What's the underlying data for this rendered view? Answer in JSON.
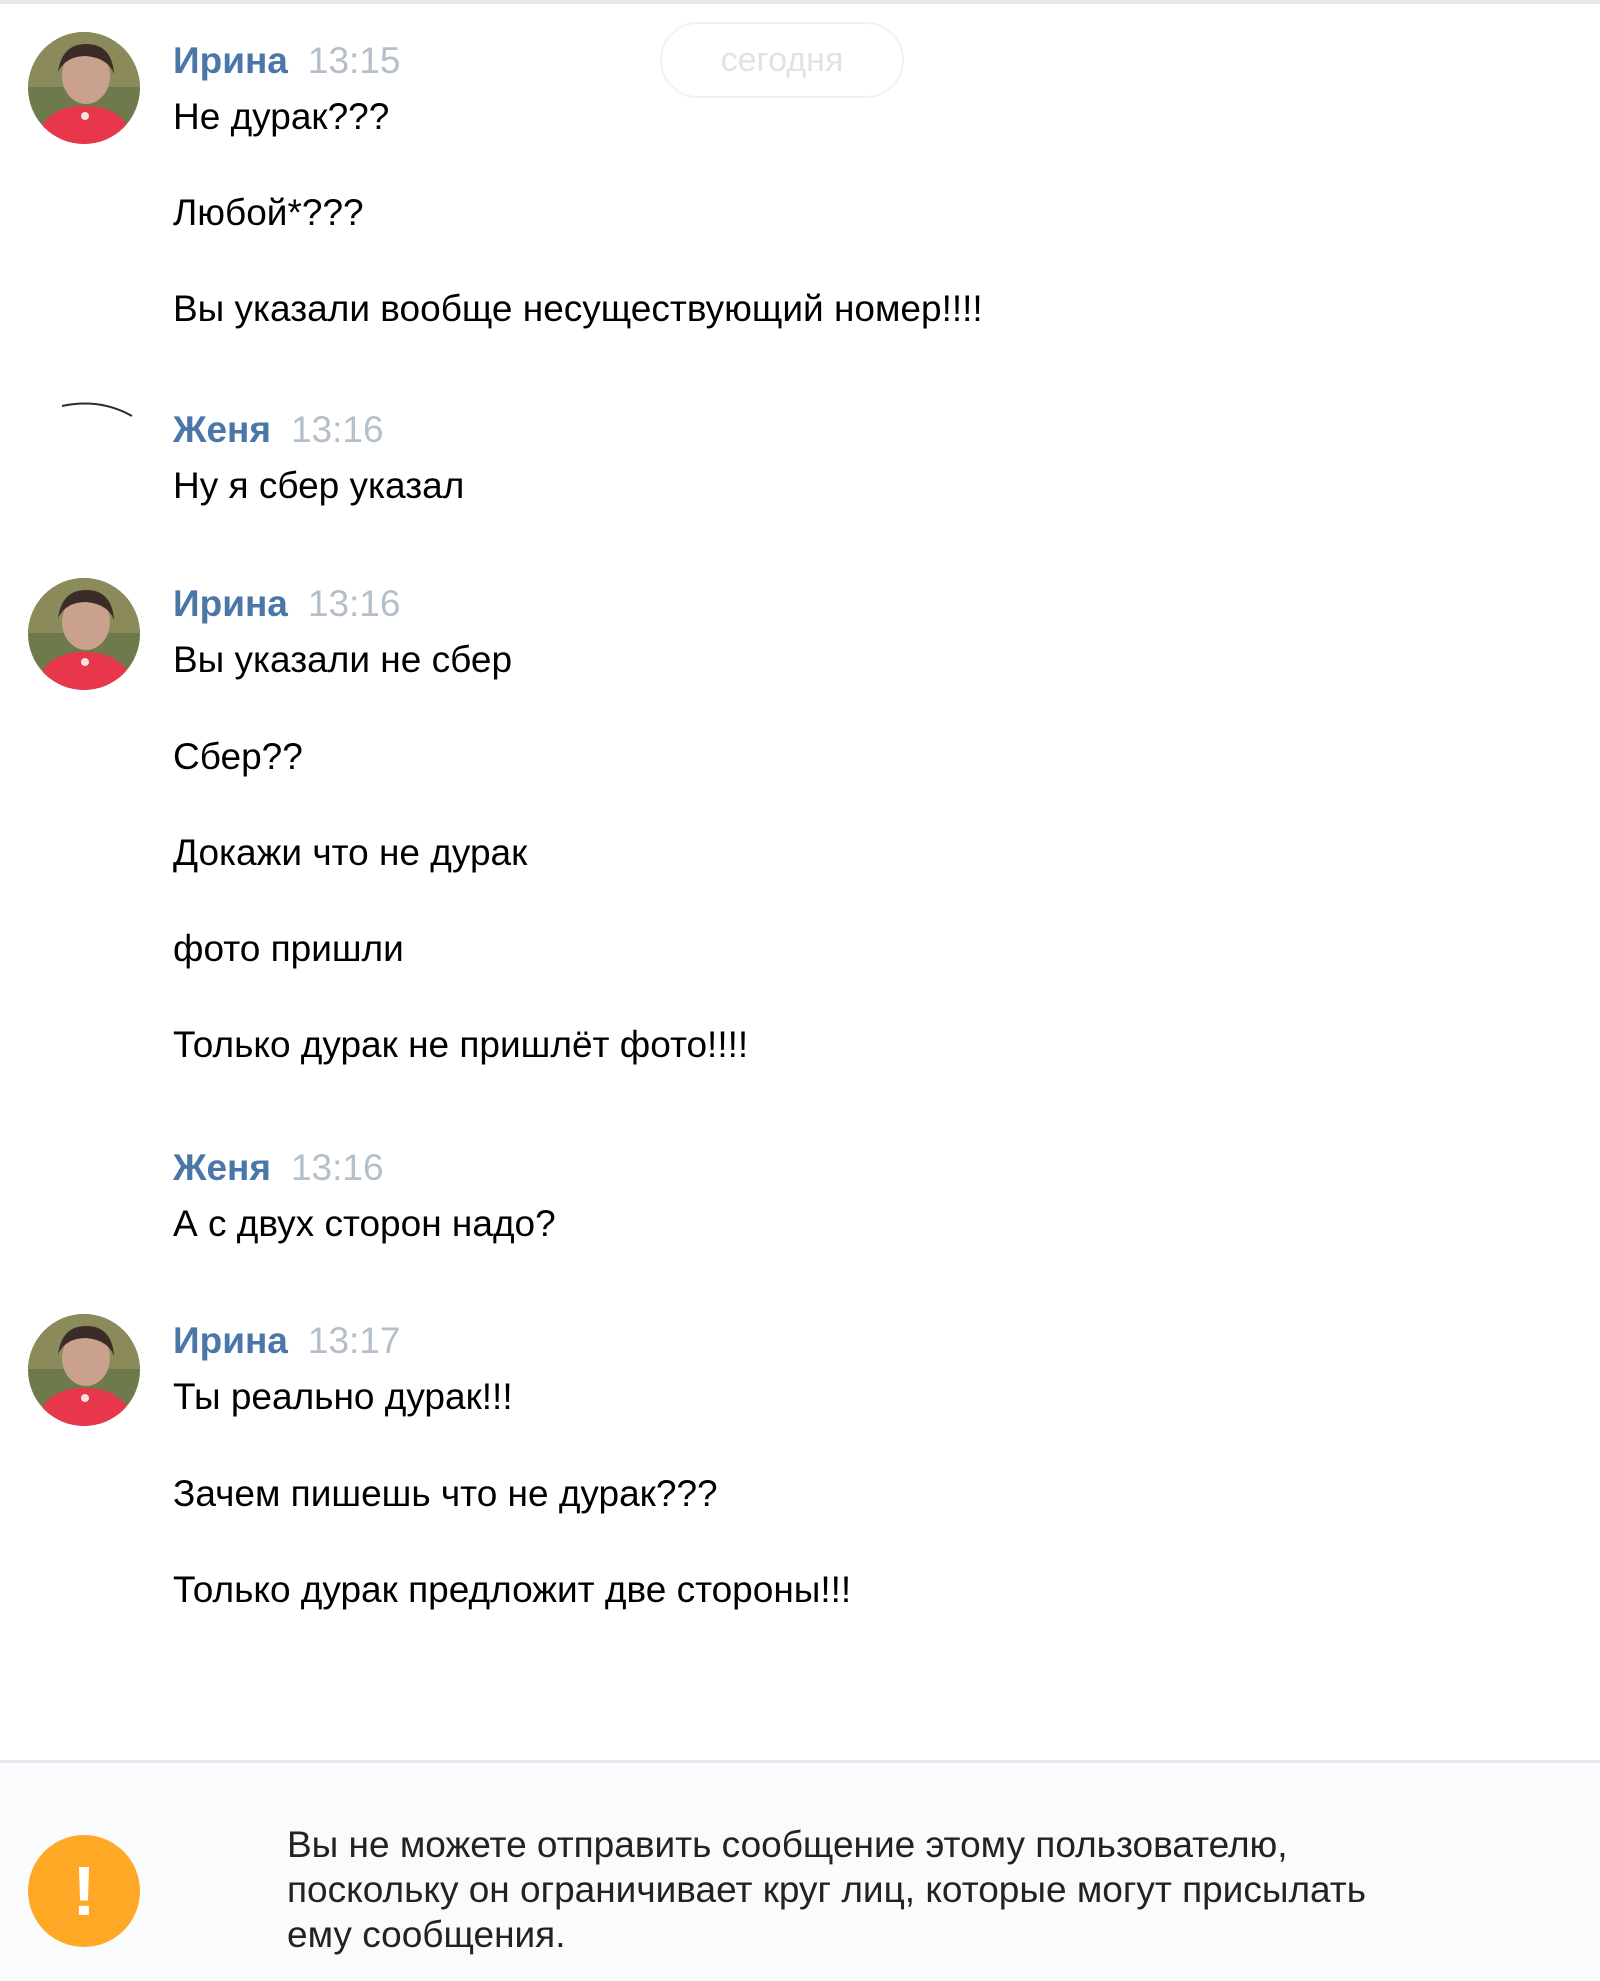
{
  "chat": {
    "date_divider": "сегодня",
    "groups": [
      {
        "sender": "Ирина",
        "time": "13:15",
        "has_avatar": true,
        "lines": [
          "Не дурак???",
          "Любой*???",
          "Вы указали вообще несуществующий номер!!!!"
        ]
      },
      {
        "sender": "Женя",
        "time": "13:16",
        "has_avatar": false,
        "lines": [
          "Ну я сбер указал"
        ]
      },
      {
        "sender": "Ирина",
        "time": "13:16",
        "has_avatar": true,
        "lines": [
          "Вы указали не сбер",
          "Сбер??",
          "Докажи что не дурак",
          "фото пришли",
          "Только дурак не пришлёт фото!!!!"
        ]
      },
      {
        "sender": "Женя",
        "time": "13:16",
        "has_avatar": false,
        "lines": [
          "А с двух сторон надо?"
        ]
      },
      {
        "sender": "Ирина",
        "time": "13:17",
        "has_avatar": true,
        "lines": [
          "Ты реально дурак!!!",
          "Зачем пишешь что не дурак???",
          "Только дурак предложит две стороны!!!"
        ]
      }
    ]
  },
  "composer": {
    "warning_icon": "exclamation-icon",
    "warning_icon_color": "#ffa826",
    "warning_symbol": "!",
    "warning_lines": [
      "Вы не можете отправить сообщение этому пользователю,",
      "поскольку он ограничивает круг лиц, которые могут присылать",
      "ему сообщения."
    ]
  },
  "colors": {
    "sender_name": "#4a76a8",
    "timestamp": "#b5bfc9",
    "message_text": "#000000"
  }
}
